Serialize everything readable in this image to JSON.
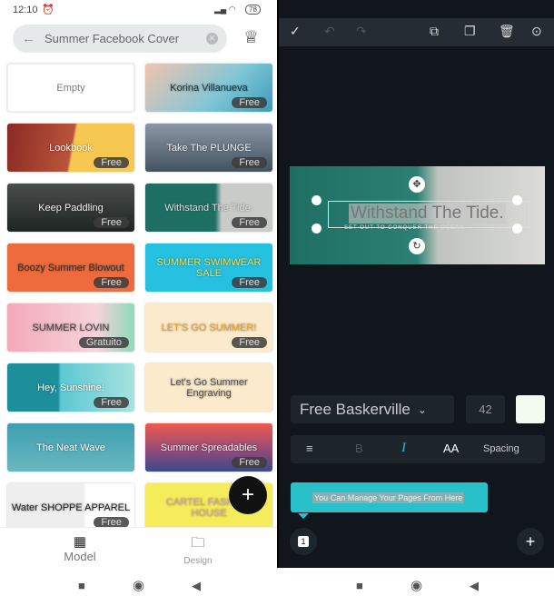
{
  "left": {
    "status": {
      "time": "12:10",
      "battery": "78"
    },
    "search": {
      "value": "Summer Facebook Cover"
    },
    "templates": [
      {
        "title": "Empty",
        "badge": "",
        "bg": "#ffffff",
        "fg": "#777777"
      },
      {
        "title": "Korina Villanueva",
        "badge": "Free",
        "bg": "linear-gradient(135deg,#f2c4b0,#7fc6d6 60%,#3a9bb8)",
        "fg": "#1a3a4a"
      },
      {
        "title": "Lookbook",
        "badge": "Free",
        "bg": "linear-gradient(100deg,#8a2a24 0%,#b9543b 50%,#f6c851 52%)",
        "fg": "#ffffff"
      },
      {
        "title": "Take The PLUNGE",
        "badge": "Free",
        "bg": "linear-gradient(180deg,#8b97a6,#44525e)",
        "fg": "#eeeeee"
      },
      {
        "title": "Keep Paddling",
        "badge": "Free",
        "bg": "linear-gradient(180deg,#4a4e4d,#1e2523)",
        "fg": "#eeeeee"
      },
      {
        "title": "Withstand The Tide.",
        "badge": "Free",
        "bg": "linear-gradient(90deg,#1f6e64 55%,#c8cbc7 60%)",
        "fg": "#dddddd"
      },
      {
        "title": "Boozy Summer Blowout",
        "badge": "Free",
        "bg": "#ee6b3d",
        "fg": "#333333"
      },
      {
        "title": "SUMMER SWIMWEAR SALE",
        "badge": "Free",
        "bg": "#26c0e0",
        "fg": "#f8e04a"
      },
      {
        "title": "SUMMER LOVIN",
        "badge": "Gratuito",
        "bg": "linear-gradient(90deg,#f3a9b8,#f7d3da 70%,#8fd8b8)",
        "fg": "#444444"
      },
      {
        "title": "LET'S GO SUMMER!",
        "badge": "Free",
        "bg": "#fbeacb",
        "fg": "#f0a426"
      },
      {
        "title": "Hey, Sunshine!",
        "badge": "Free",
        "bg": "linear-gradient(90deg,#1d8f9a 40%,#5cc8d2 42%,#a7e2df)",
        "fg": "#ffffff"
      },
      {
        "title": "Let's Go Summer Engraving",
        "badge": "",
        "bg": "#fbeacb",
        "fg": "#555555"
      },
      {
        "title": "The Neat Wave",
        "badge": "",
        "bg": "linear-gradient(180deg,#3e9fb0,#6ab7c2)",
        "fg": "#ffffff"
      },
      {
        "title": "Summer Spreadables",
        "badge": "Free",
        "bg": "linear-gradient(180deg,#ef5b50,#8a4a7a 60%,#3a4a8a)",
        "fg": "#eeeeee"
      },
      {
        "title": "Water SHOPPE APPAREL",
        "badge": "Free",
        "bg": "linear-gradient(90deg,#eeeeee 60%,#ffffff 62%)",
        "fg": "#222222"
      },
      {
        "title": "CARTEL FASHION HOUSE",
        "badge": "",
        "bg": "#f4ec5a",
        "fg": "#d9a0c8"
      }
    ],
    "nav": [
      {
        "label": "Model",
        "icon": "grid-icon"
      },
      {
        "label": "Design",
        "icon": "folder-icon"
      }
    ],
    "fab": "+"
  },
  "right": {
    "toolbar": {
      "check": "✓",
      "undo": "↶",
      "redo": "↷"
    },
    "canvas": {
      "title": "Withstand The Tide.",
      "subtitle": "SET OUT TO CONQUER THE OCEAN"
    },
    "font": {
      "name": "Free Baskerville",
      "size": "42",
      "color": "#f3fbf1"
    },
    "format": {
      "bold": "B",
      "italic": "I",
      "case": "AA",
      "spacing": "Spacing"
    },
    "tooltip": "You Can Manage Your Pages From Here",
    "page_number": "1",
    "add": "+",
    "accent": "#28c1c9"
  }
}
